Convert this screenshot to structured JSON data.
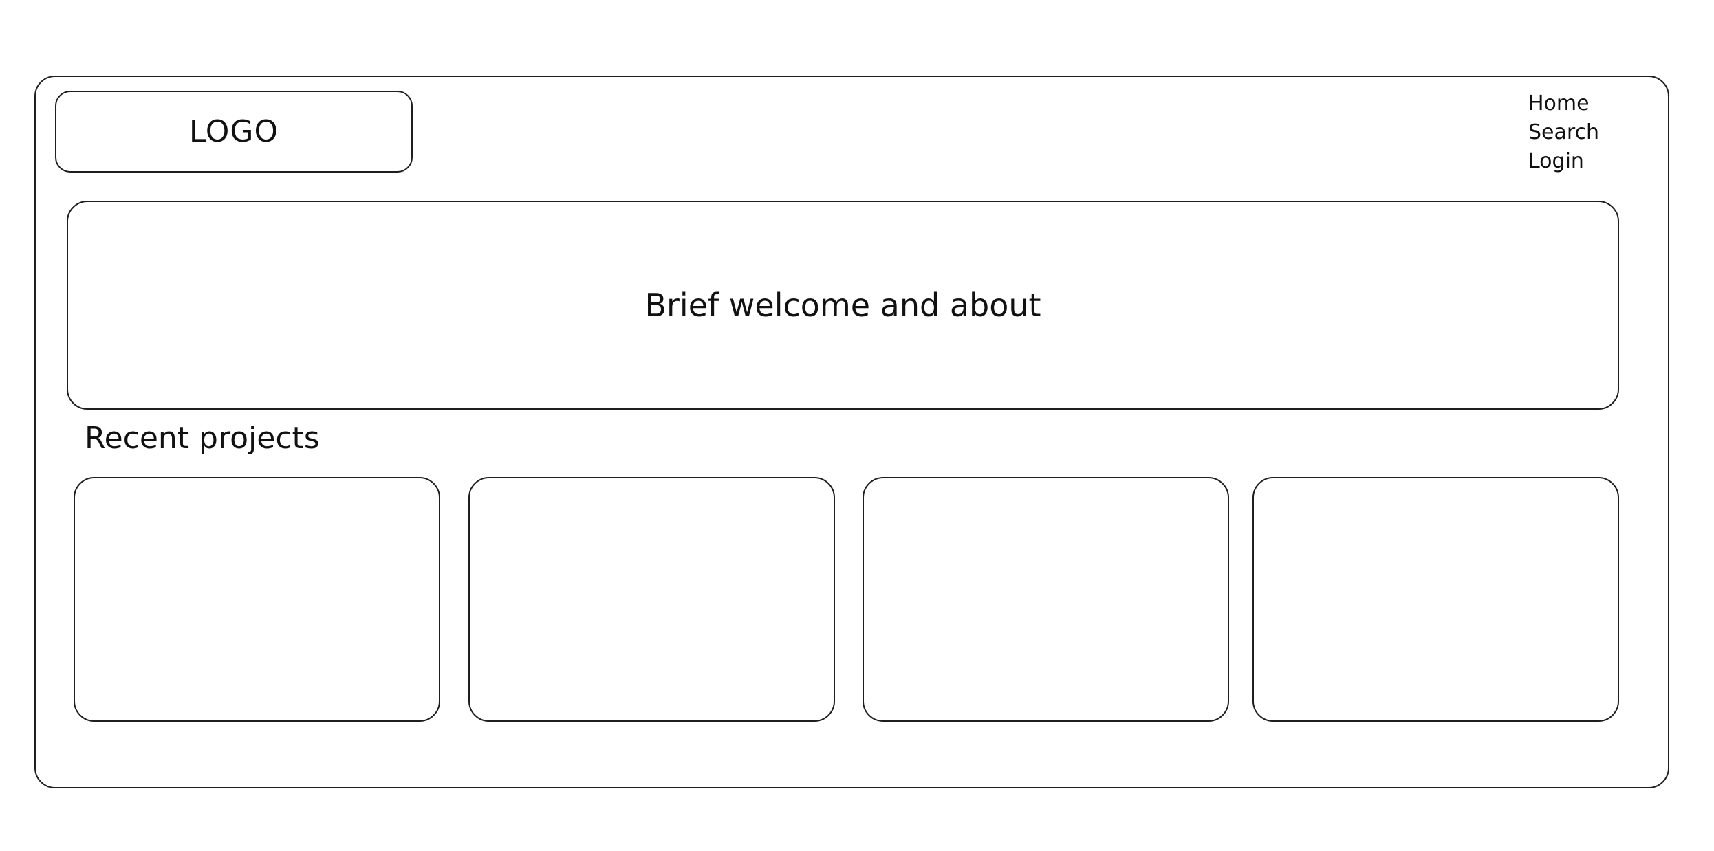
{
  "header": {
    "logo_text": "LOGO",
    "nav": [
      {
        "label": "Home"
      },
      {
        "label": "Search"
      },
      {
        "label": "Login"
      }
    ]
  },
  "hero": {
    "text": "Brief welcome and about"
  },
  "recent_projects": {
    "title": "Recent projects",
    "card_count": 4
  }
}
